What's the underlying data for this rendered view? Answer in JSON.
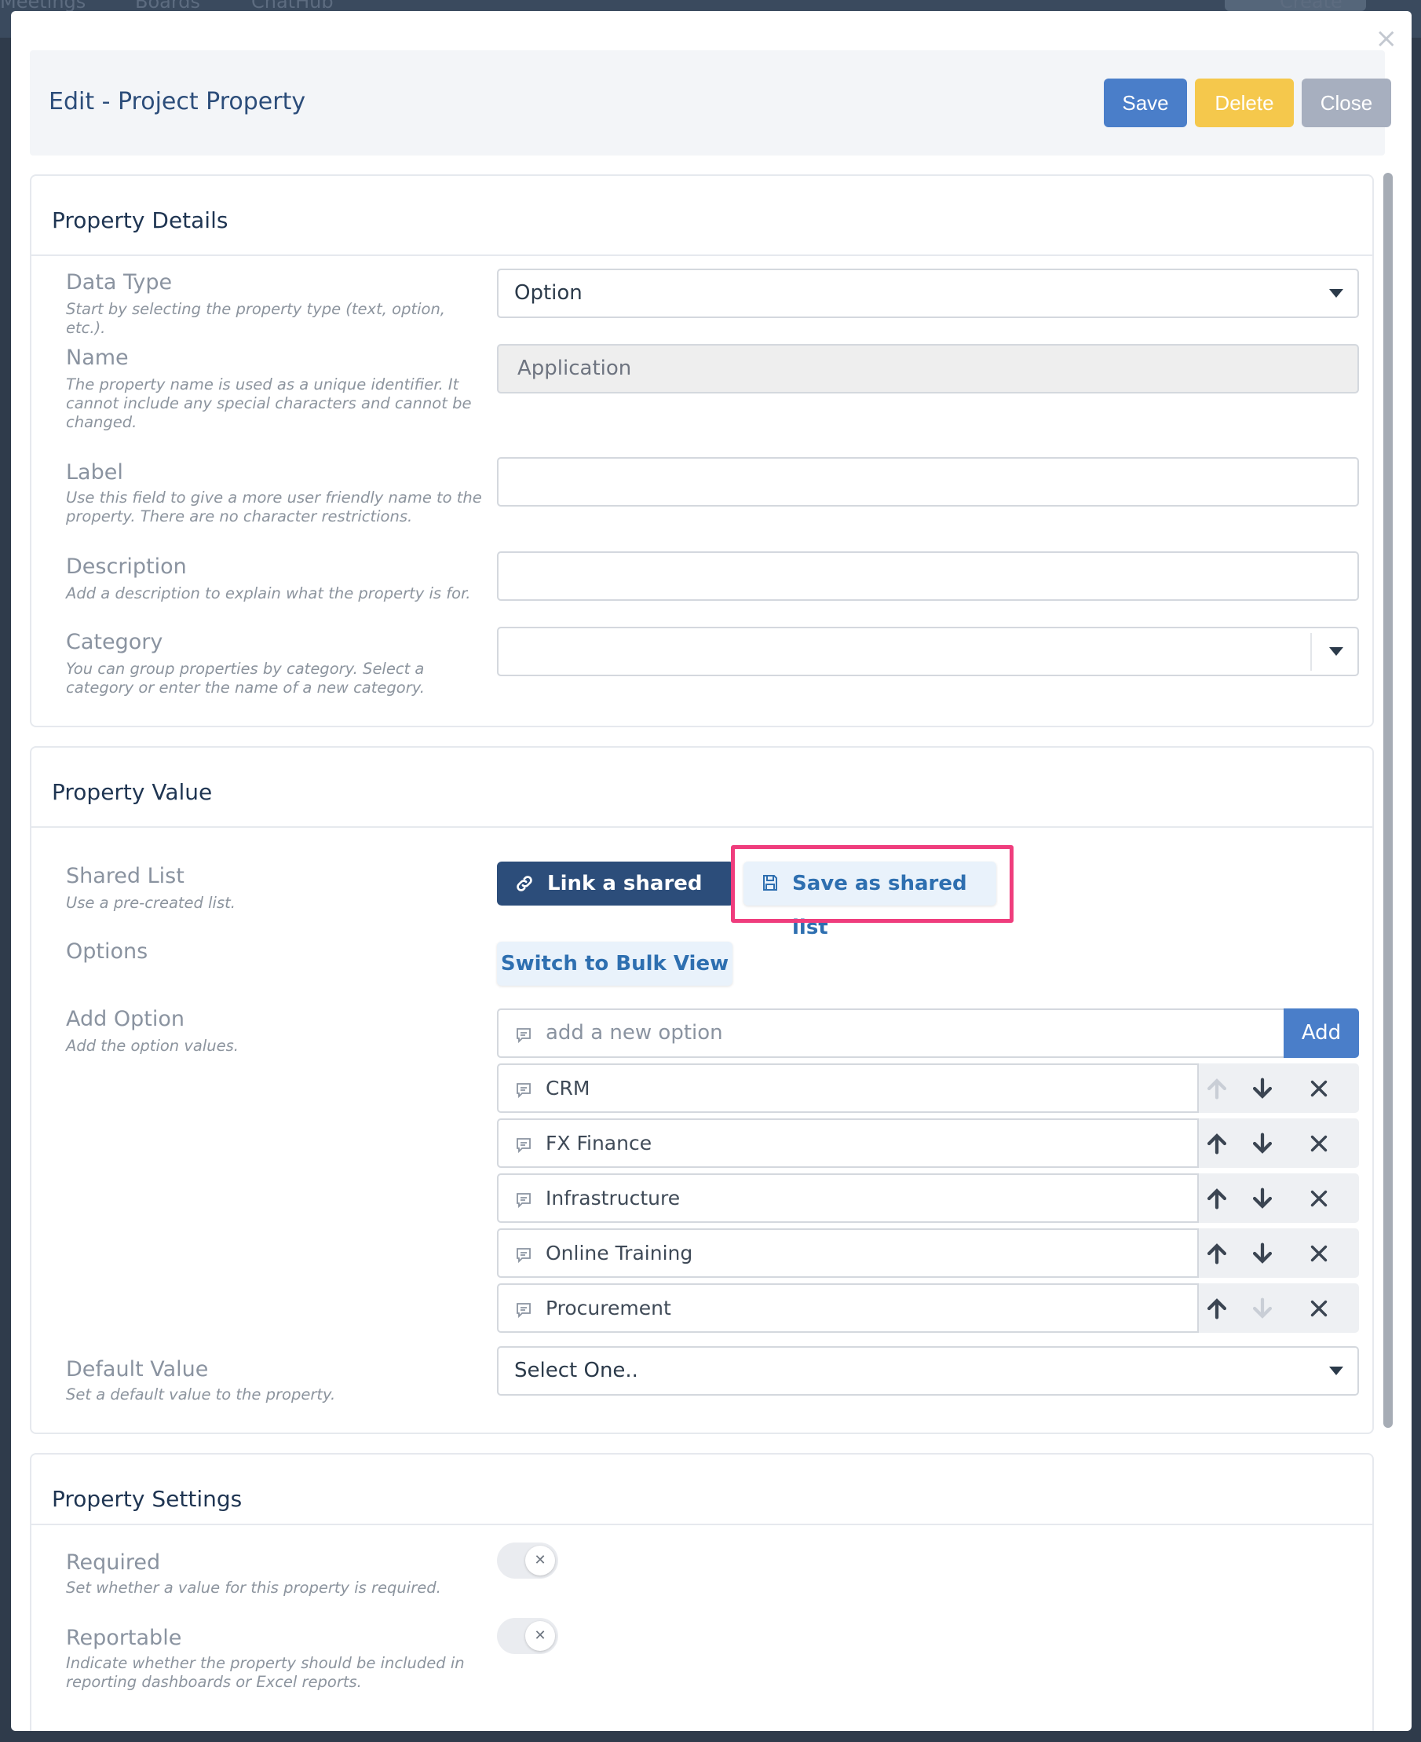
{
  "background_nav": {
    "items": [
      "Meetings",
      "Boards",
      "ChatHub"
    ],
    "create_label": "Create"
  },
  "modal": {
    "title": "Edit - Project Property",
    "save_label": "Save",
    "delete_label": "Delete",
    "close_label": "Close"
  },
  "property_details": {
    "title": "Property Details",
    "data_type": {
      "label": "Data Type",
      "hint": "Start by selecting the property type (text, option, etc.).",
      "value": "Option"
    },
    "name": {
      "label": "Name",
      "hint": "The property name is used as a unique identifier. It cannot include any special characters and cannot be changed.",
      "value": "Application"
    },
    "label_field": {
      "label": "Label",
      "hint": "Use this field to give a more user friendly name to the property. There are no character restrictions.",
      "value": ""
    },
    "description": {
      "label": "Description",
      "hint": "Add a description to explain what the property is for.",
      "value": ""
    },
    "category": {
      "label": "Category",
      "hint": "You can group properties by category. Select a category or enter the name of a new category.",
      "value": ""
    }
  },
  "property_value": {
    "title": "Property Value",
    "shared_list": {
      "label": "Shared List",
      "hint": "Use a pre-created list.",
      "link_label": "Link a shared list",
      "save_label": "Save as shared list"
    },
    "options": {
      "label": "Options",
      "bulk_label": "Switch to Bulk View"
    },
    "add_option": {
      "label": "Add Option",
      "hint": "Add the option values.",
      "placeholder": "add a new option",
      "add_label": "Add"
    },
    "option_items": [
      {
        "value": "CRM",
        "up_enabled": false,
        "down_enabled": true
      },
      {
        "value": "FX Finance",
        "up_enabled": true,
        "down_enabled": true
      },
      {
        "value": "Infrastructure",
        "up_enabled": true,
        "down_enabled": true
      },
      {
        "value": "Online Training",
        "up_enabled": true,
        "down_enabled": true
      },
      {
        "value": "Procurement",
        "up_enabled": true,
        "down_enabled": false
      }
    ],
    "default_value": {
      "label": "Default Value",
      "hint": "Set a default value to the property.",
      "value": "Select One.."
    }
  },
  "property_settings": {
    "title": "Property Settings",
    "required": {
      "label": "Required",
      "hint": "Set whether a value for this property is required.",
      "enabled": false
    },
    "reportable": {
      "label": "Reportable",
      "hint": "Indicate whether the property should be included in reporting dashboards or Excel reports.",
      "enabled": false
    }
  },
  "colors": {
    "primary": "#4a7ec9",
    "warning": "#f5c84c",
    "navy": "#2c4d7a",
    "highlight": "#ef3d7d"
  }
}
